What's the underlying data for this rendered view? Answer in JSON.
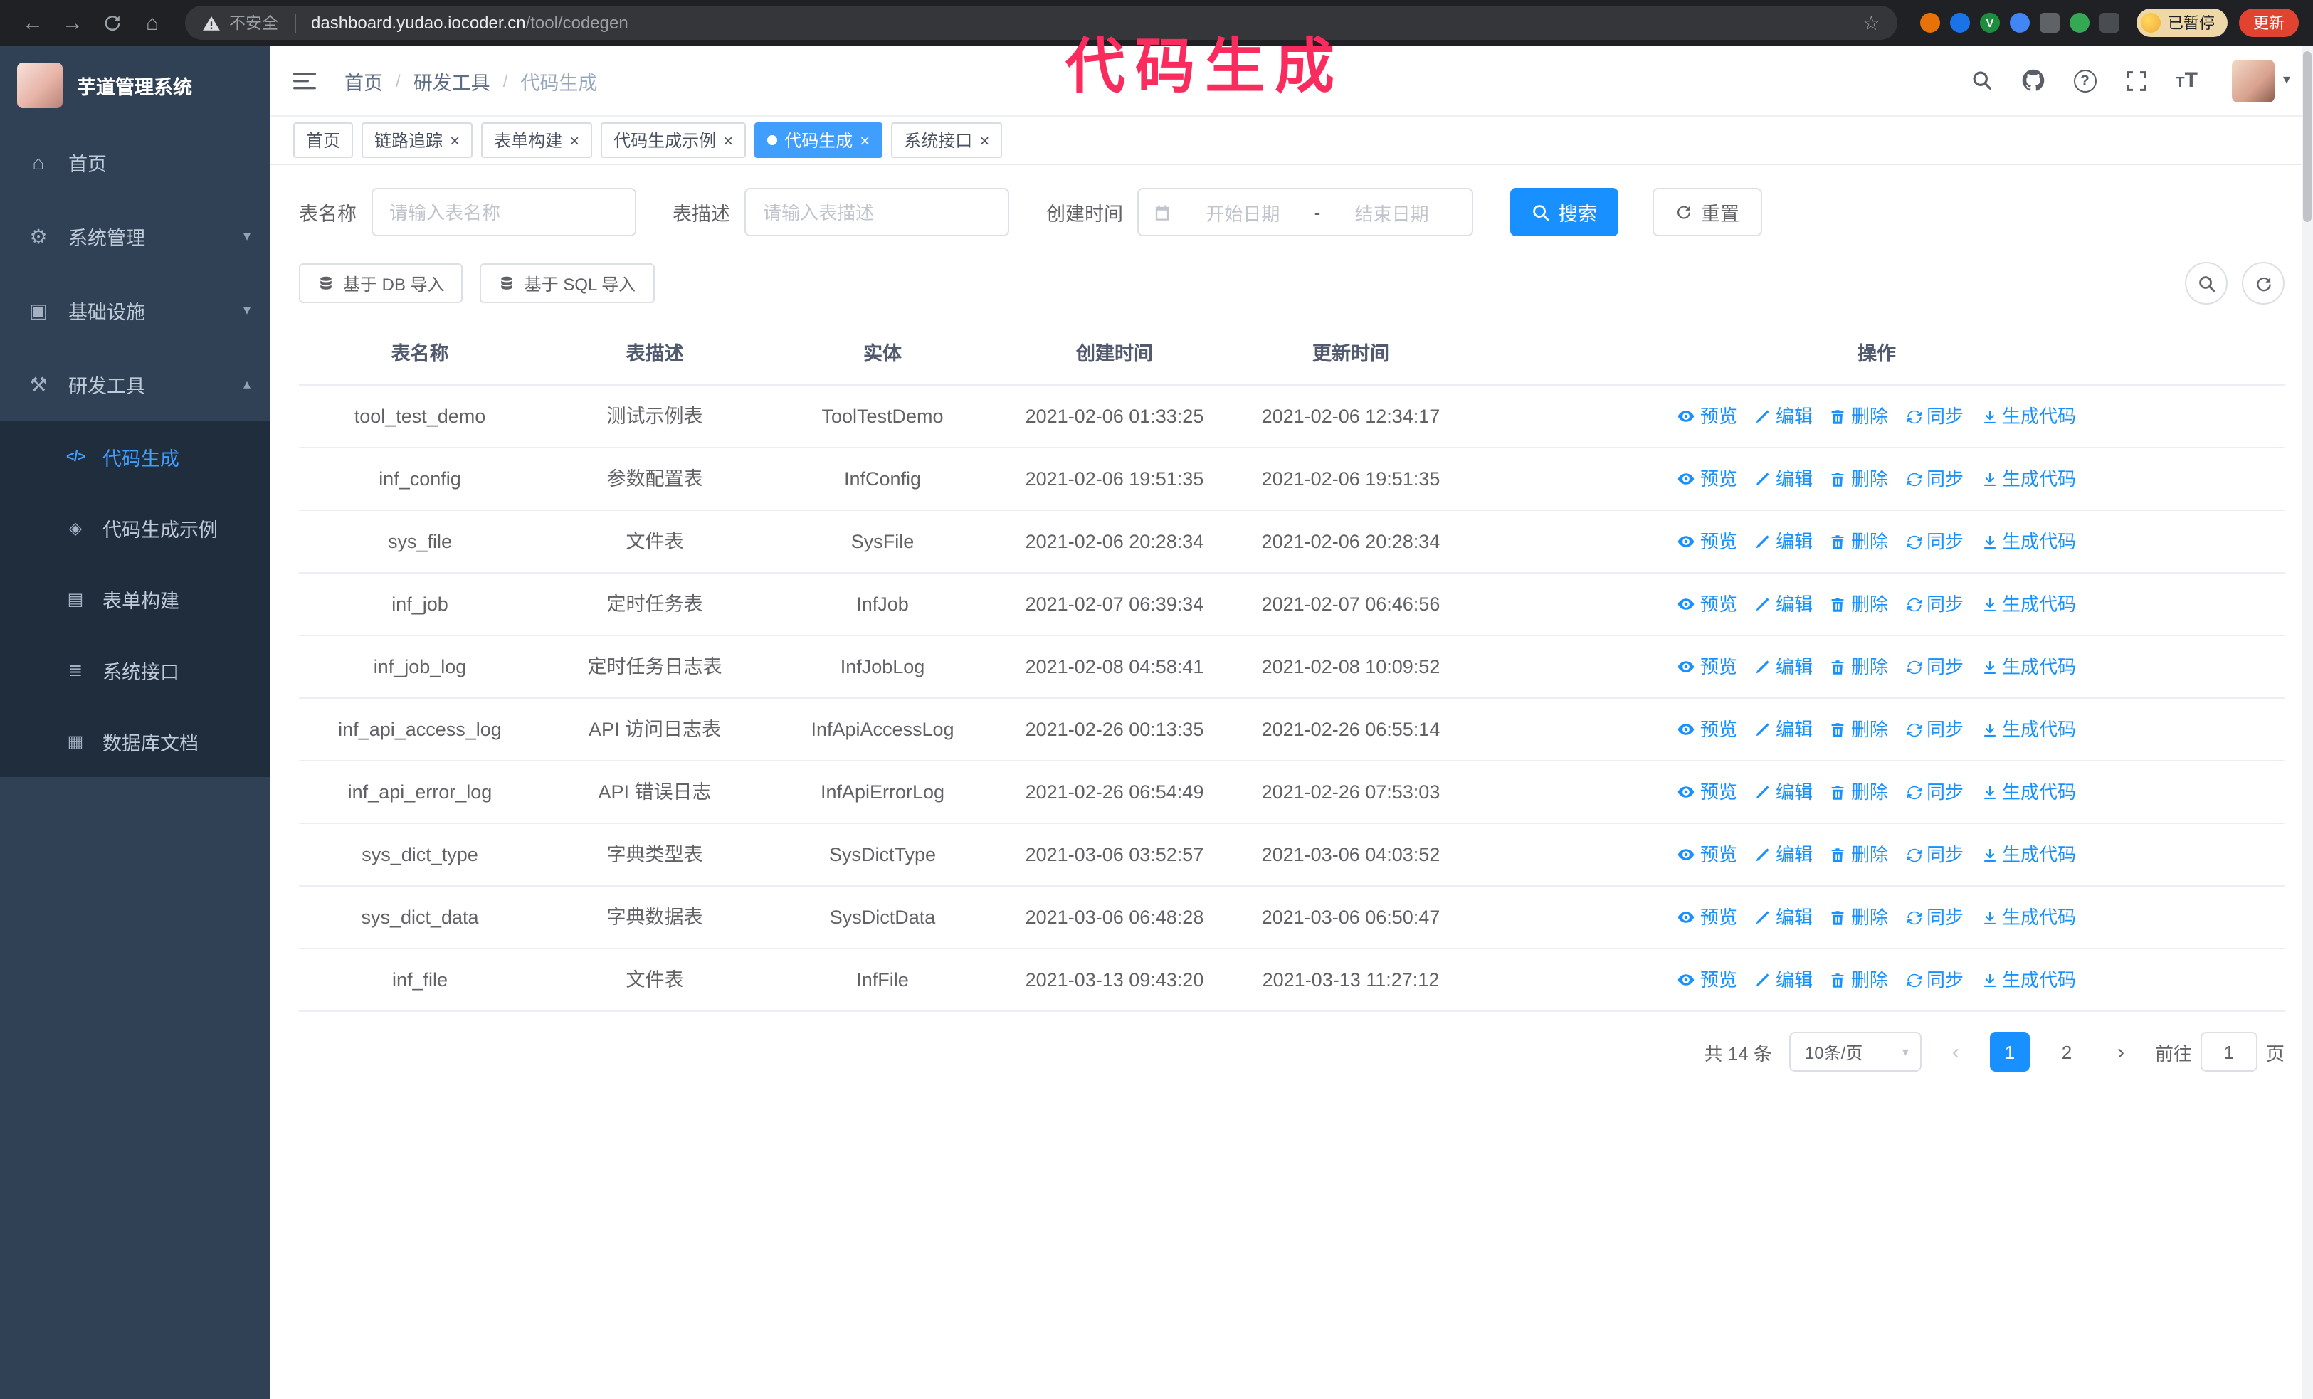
{
  "colors": {
    "accent": "#1890ff",
    "tab_active": "#409eff",
    "sidebar_bg": "#304156",
    "submenu_bg": "#1f2d3d",
    "annotation": "#fa2c5e"
  },
  "icons": {
    "back": "←",
    "forward": "→",
    "home": "⌂",
    "star": "☆",
    "menu_home": "⌂",
    "menu_system": "⚙",
    "menu_infra": "▣",
    "menu_tools": "⚒",
    "menu_codegen": "</>",
    "menu_demo": "◈",
    "menu_form": "▤",
    "menu_api": "≣",
    "menu_db": "▦",
    "chevron_down": "▾",
    "chevron_up": "▴",
    "caret_down": "▾",
    "close": "×",
    "question": "?",
    "font_small": "T",
    "font_large": "T",
    "prev": "‹",
    "next": "›"
  },
  "browser": {
    "security_text": "不安全",
    "url_host": "dashboard.yudao.iocoder.cn",
    "url_path": "/tool/codegen",
    "paused_label": "已暂停",
    "update_label": "更新"
  },
  "overlay": {
    "title": "代码生成"
  },
  "sidebar": {
    "logo_title": "芋道管理系统",
    "items": [
      {
        "label": "首页"
      },
      {
        "label": "系统管理"
      },
      {
        "label": "基础设施"
      },
      {
        "label": "研发工具"
      }
    ],
    "subitems": [
      {
        "label": "代码生成",
        "active": true
      },
      {
        "label": "代码生成示例"
      },
      {
        "label": "表单构建"
      },
      {
        "label": "系统接口"
      },
      {
        "label": "数据库文档"
      }
    ]
  },
  "topbar": {
    "breadcrumb": [
      "首页",
      "研发工具",
      "代码生成"
    ],
    "separator": "/"
  },
  "tabs": [
    {
      "label": "首页",
      "closable": false,
      "active": false
    },
    {
      "label": "链路追踪",
      "closable": true,
      "active": false
    },
    {
      "label": "表单构建",
      "closable": true,
      "active": false
    },
    {
      "label": "代码生成示例",
      "closable": true,
      "active": false
    },
    {
      "label": "代码生成",
      "closable": true,
      "active": true
    },
    {
      "label": "系统接口",
      "closable": true,
      "active": false
    }
  ],
  "filters": {
    "table_name_label": "表名称",
    "table_name_placeholder": "请输入表名称",
    "table_desc_label": "表描述",
    "table_desc_placeholder": "请输入表描述",
    "create_time_label": "创建时间",
    "date_start_placeholder": "开始日期",
    "date_separator": "-",
    "date_end_placeholder": "结束日期",
    "search_button": "搜索",
    "reset_button": "重置"
  },
  "toolbar": {
    "import_db_label": "基于 DB 导入",
    "import_sql_label": "基于 SQL 导入"
  },
  "table": {
    "columns": [
      "表名称",
      "表描述",
      "实体",
      "创建时间",
      "更新时间",
      "操作"
    ],
    "actions": [
      "预览",
      "编辑",
      "删除",
      "同步",
      "生成代码"
    ],
    "rows": [
      {
        "name": "tool_test_demo",
        "desc": "测试示例表",
        "entity": "ToolTestDemo",
        "created": "2021-02-06 01:33:25",
        "updated": "2021-02-06 12:34:17"
      },
      {
        "name": "inf_config",
        "desc": "参数配置表",
        "entity": "InfConfig",
        "created": "2021-02-06 19:51:35",
        "updated": "2021-02-06 19:51:35"
      },
      {
        "name": "sys_file",
        "desc": "文件表",
        "entity": "SysFile",
        "created": "2021-02-06 20:28:34",
        "updated": "2021-02-06 20:28:34"
      },
      {
        "name": "inf_job",
        "desc": "定时任务表",
        "entity": "InfJob",
        "created": "2021-02-07 06:39:34",
        "updated": "2021-02-07 06:46:56"
      },
      {
        "name": "inf_job_log",
        "desc": "定时任务日志表",
        "entity": "InfJobLog",
        "created": "2021-02-08 04:58:41",
        "updated": "2021-02-08 10:09:52"
      },
      {
        "name": "inf_api_access_log",
        "desc": "API 访问日志表",
        "entity": "InfApiAccessLog",
        "created": "2021-02-26 00:13:35",
        "updated": "2021-02-26 06:55:14"
      },
      {
        "name": "inf_api_error_log",
        "desc": "API 错误日志",
        "entity": "InfApiErrorLog",
        "created": "2021-02-26 06:54:49",
        "updated": "2021-02-26 07:53:03"
      },
      {
        "name": "sys_dict_type",
        "desc": "字典类型表",
        "entity": "SysDictType",
        "created": "2021-03-06 03:52:57",
        "updated": "2021-03-06 04:03:52"
      },
      {
        "name": "sys_dict_data",
        "desc": "字典数据表",
        "entity": "SysDictData",
        "created": "2021-03-06 06:48:28",
        "updated": "2021-03-06 06:50:47"
      },
      {
        "name": "inf_file",
        "desc": "文件表",
        "entity": "InfFile",
        "created": "2021-03-13 09:43:20",
        "updated": "2021-03-13 11:27:12"
      }
    ]
  },
  "pagination": {
    "total": "共 14 条",
    "page_size": "10条/页",
    "pages": [
      "1",
      "2"
    ],
    "goto_label": "前往",
    "goto_value": "1",
    "goto_suffix": "页"
  }
}
